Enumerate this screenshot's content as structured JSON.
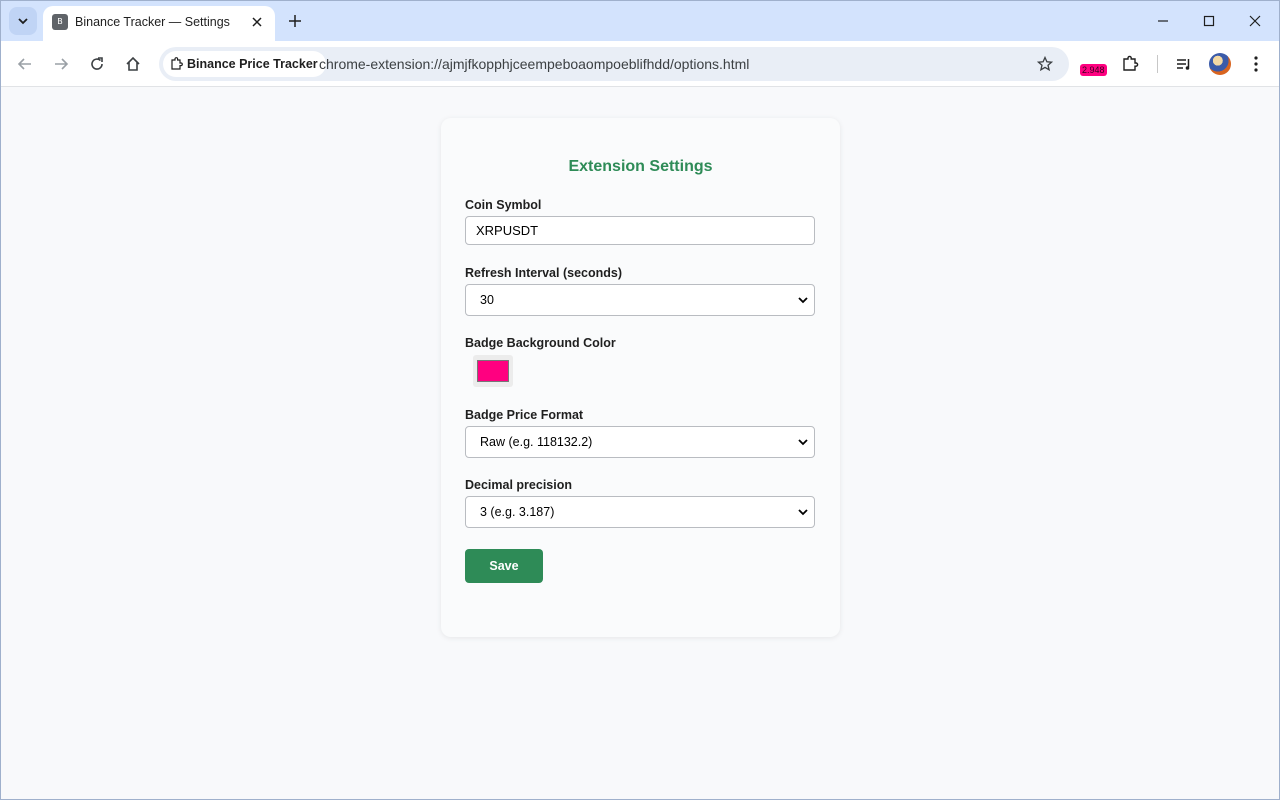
{
  "browser": {
    "tab_title": "Binance Tracker — Settings",
    "tab_favicon_letter": "B",
    "site_chip_label": "Binance Price Tracker",
    "url": "chrome-extension://ajmjfkopphjceempeboaompoeblifhdd/options.html",
    "extension_badge_text": "2.948",
    "extension_badge_color": "#ff0080"
  },
  "settings": {
    "title": "Extension Settings",
    "coin_symbol": {
      "label": "Coin Symbol",
      "value": "XRPUSDT"
    },
    "refresh_interval": {
      "label": "Refresh Interval (seconds)",
      "value": "30"
    },
    "badge_color": {
      "label": "Badge Background Color",
      "value": "#ff0080"
    },
    "badge_format": {
      "label": "Badge Price Format",
      "value": "Raw (e.g. 118132.2)"
    },
    "decimal_precision": {
      "label": "Decimal precision",
      "value": "3 (e.g. 3.187)"
    },
    "save_label": "Save"
  },
  "colors": {
    "accent": "#2e8b57",
    "tabstrip": "#d3e3fd",
    "page_bg": "#f8f9fb"
  }
}
